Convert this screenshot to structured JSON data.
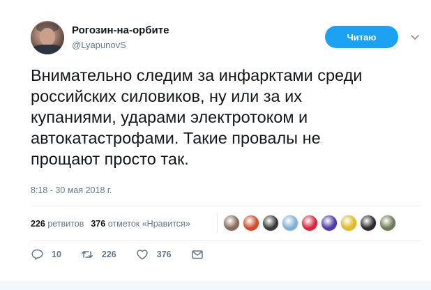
{
  "tweet": {
    "display_name": "Рогозин-на-орбите",
    "handle": "@LyapunovS",
    "follow_label": "Читаю",
    "text": "Внимательно следим за инфарктами среди\nроссийских силовиков, ну или за их\nкупаниями, ударами электротоком и\nавтокатастрофами. Такие провалы не\nпрощают просто так.",
    "timestamp": "8:18 - 30 мая 2018 г."
  },
  "stats": {
    "retweets_count": "226",
    "retweets_label": "ретвитов",
    "likes_count": "376",
    "likes_label": "отметок «Нравится»"
  },
  "likers": [
    {
      "color": "#8a6a5a"
    },
    {
      "color": "#d24a2a"
    },
    {
      "color": "#3a3a3a"
    },
    {
      "color": "#7fb0d6"
    },
    {
      "color": "#d8243c"
    },
    {
      "color": "#4b3aa8"
    },
    {
      "color": "#e0b81f"
    },
    {
      "color": "#2b2b2b"
    },
    {
      "color": "#6f7a55"
    }
  ],
  "actions": {
    "reply_count": "10",
    "retweet_count": "226",
    "like_count": "376"
  },
  "icons": {
    "reply": "reply-icon",
    "retweet": "retweet-icon",
    "like": "heart-icon",
    "dm": "envelope-icon",
    "menu": "chevron-down-icon"
  },
  "colors": {
    "accent": "#1da1f2",
    "secondary_text": "#657786",
    "primary_text": "#14171a"
  }
}
